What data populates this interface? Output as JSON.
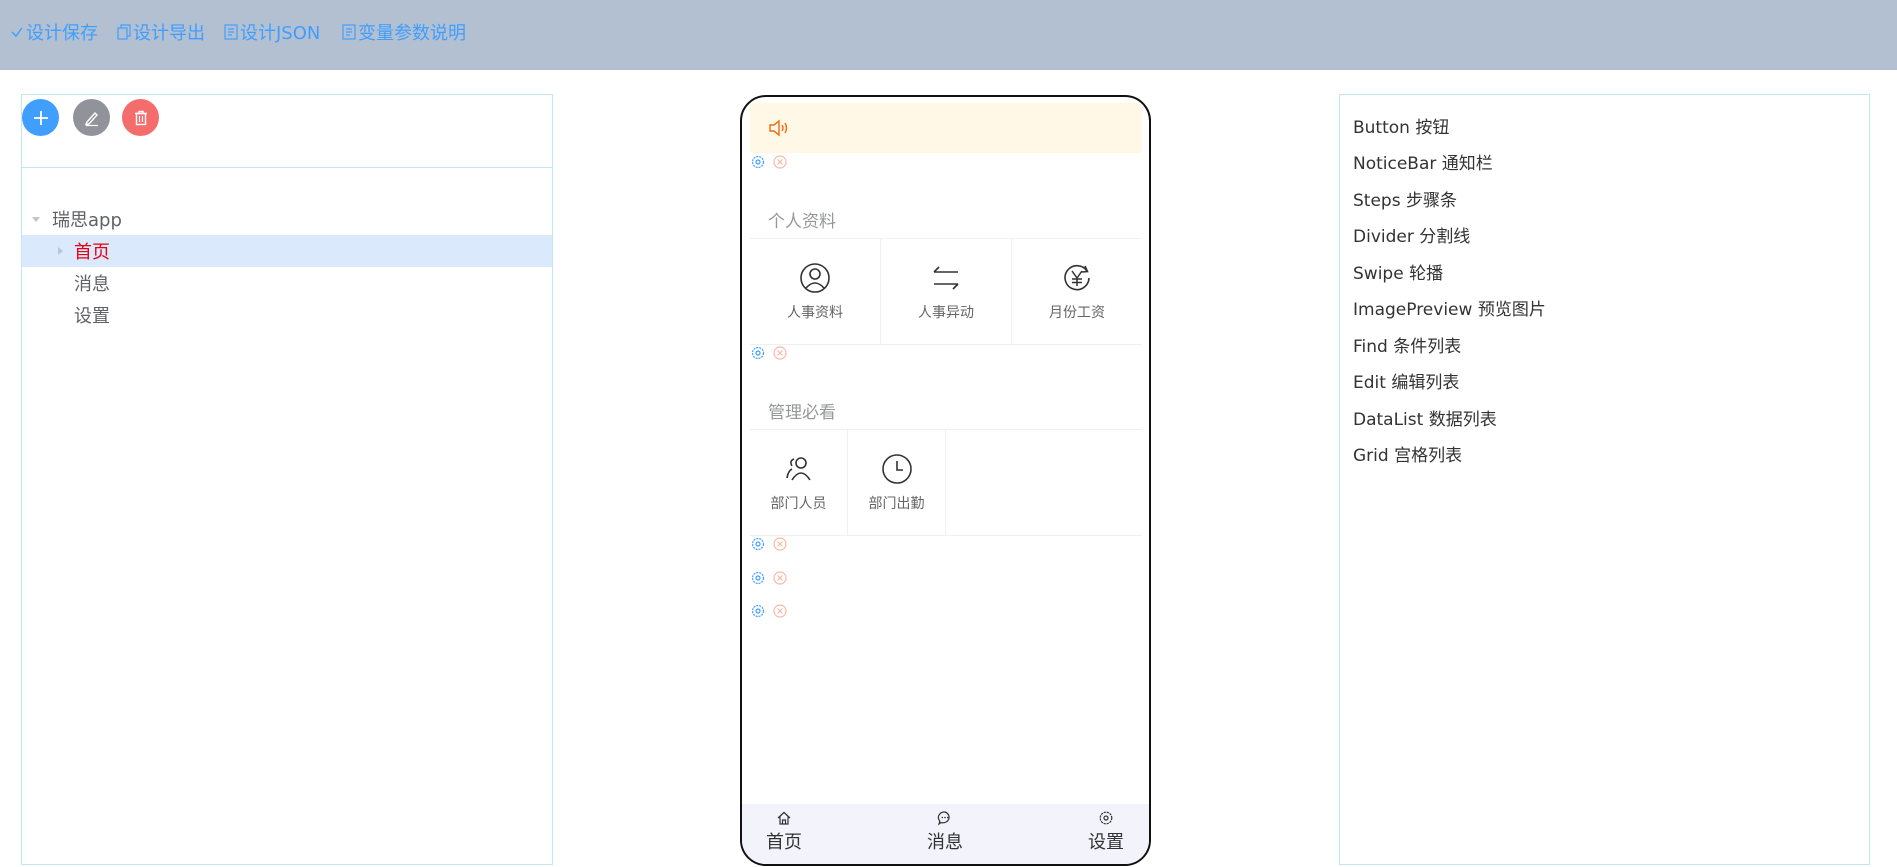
{
  "toolbar": {
    "save": "设计保存",
    "export": "设计导出",
    "json": "设计JSON",
    "vars": "变量参数说明"
  },
  "tree": {
    "root": "瑞思app",
    "children": [
      "首页",
      "消息",
      "设置"
    ]
  },
  "phone": {
    "sections": [
      {
        "title": "个人资料",
        "items": [
          "人事资料",
          "人事异动",
          "月份工资"
        ]
      },
      {
        "title": "管理必看",
        "items": [
          "部门人员",
          "部门出勤"
        ]
      }
    ],
    "tabs": [
      "首页",
      "消息",
      "设置"
    ]
  },
  "components": [
    "Button 按钮",
    "NoticeBar 通知栏",
    "Steps 步骤条",
    "Divider 分割线",
    "Swipe 轮播",
    "ImagePreview 预览图片",
    "Find 条件列表",
    "Edit 编辑列表",
    "DataList 数据列表",
    "Grid 宫格列表"
  ],
  "colors": {
    "accent": "#409eff",
    "topbar": "#b3c0d1",
    "selected_text": "#e60012",
    "notice_bg": "#fff8e6",
    "delete": "#f56c6c"
  }
}
